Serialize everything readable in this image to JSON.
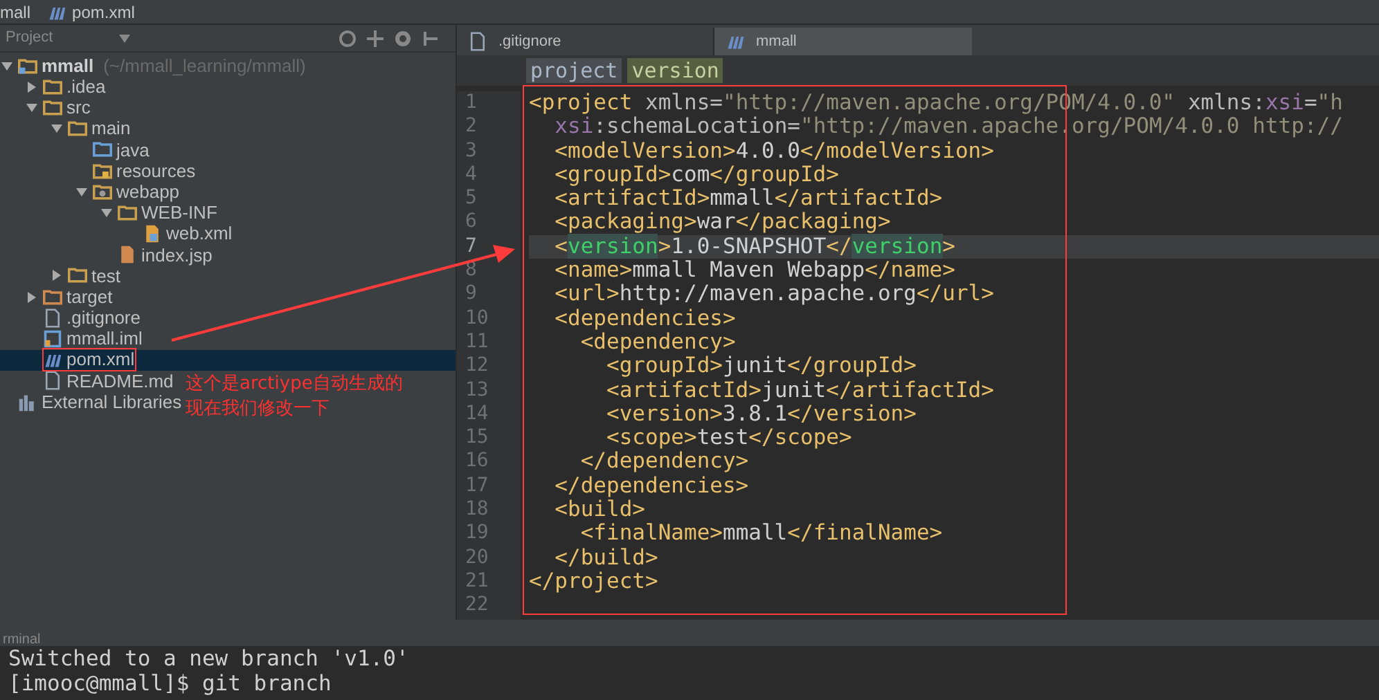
{
  "title_bar": {
    "crumbs": [
      "mall",
      "pom.xml"
    ]
  },
  "project_panel": {
    "title": "Project",
    "tree": [
      {
        "label": "mmall",
        "hint": "(~/mmall_learning/mmall)",
        "kind": "module",
        "expanded": true,
        "selected": false,
        "children": [
          {
            "label": ".idea",
            "kind": "folder",
            "expanded": false,
            "selected": false
          },
          {
            "label": "src",
            "kind": "folder",
            "expanded": true,
            "selected": false,
            "children": [
              {
                "label": "main",
                "kind": "folder",
                "expanded": true,
                "selected": false,
                "children": [
                  {
                    "label": "java",
                    "kind": "source",
                    "selected": false
                  },
                  {
                    "label": "resources",
                    "kind": "resources",
                    "selected": false
                  },
                  {
                    "label": "webapp",
                    "kind": "web",
                    "expanded": true,
                    "selected": false,
                    "children": [
                      {
                        "label": "WEB-INF",
                        "kind": "folder",
                        "expanded": true,
                        "selected": false,
                        "children": [
                          {
                            "label": "web.xml",
                            "kind": "xml",
                            "selected": false
                          }
                        ]
                      },
                      {
                        "label": "index.jsp",
                        "kind": "jsp",
                        "selected": false
                      }
                    ]
                  }
                ]
              },
              {
                "label": "test",
                "kind": "folder",
                "expanded": false,
                "selected": false
              }
            ]
          },
          {
            "label": "target",
            "kind": "excluded",
            "expanded": false,
            "selected": false
          },
          {
            "label": ".gitignore",
            "kind": "file",
            "selected": false
          },
          {
            "label": "mmall.iml",
            "kind": "iml",
            "selected": false
          },
          {
            "label": "pom.xml",
            "kind": "maven",
            "selected": true
          },
          {
            "label": "README.md",
            "kind": "file",
            "selected": false
          }
        ]
      },
      {
        "label": "External Libraries",
        "kind": "libraries",
        "selected": false
      }
    ]
  },
  "editor": {
    "tabs": [
      {
        "label": ".gitignore",
        "kind": "file",
        "selected": false
      },
      {
        "label": "mmall",
        "kind": "maven",
        "selected": true
      }
    ],
    "breadcrumbs": [
      {
        "label": "project",
        "selected": false
      },
      {
        "label": "version",
        "selected": true
      }
    ],
    "lines": [
      {
        "number": "1",
        "current": false,
        "tokens": [
          {
            "text": "<project",
            "kind": "tag"
          },
          {
            "text": " xmlns=",
            "kind": "attr"
          },
          {
            "text": "\"http://maven.apache.org/POM/4.0.0\"",
            "kind": "value"
          },
          {
            "text": " xmlns:",
            "kind": "attr"
          },
          {
            "text": "xsi",
            "kind": "ns"
          },
          {
            "text": "=",
            "kind": "attr"
          },
          {
            "text": "\"h",
            "kind": "value"
          }
        ]
      },
      {
        "number": "2",
        "current": false,
        "tokens": [
          {
            "text": "  xsi",
            "kind": "ns"
          },
          {
            "text": ":schemaLocation=",
            "kind": "attr"
          },
          {
            "text": "\"http://maven.apache.org/POM/4.0.0 http://",
            "kind": "value"
          }
        ]
      },
      {
        "number": "3",
        "current": false,
        "tokens": [
          {
            "text": "  <modelVersion>",
            "kind": "tag"
          },
          {
            "text": "4.0.0",
            "kind": "text"
          },
          {
            "text": "</modelVersion>",
            "kind": "tag"
          }
        ]
      },
      {
        "number": "4",
        "current": false,
        "tokens": [
          {
            "text": "  <groupId>",
            "kind": "tag"
          },
          {
            "text": "com",
            "kind": "text"
          },
          {
            "text": "</groupId>",
            "kind": "tag"
          }
        ]
      },
      {
        "number": "5",
        "current": false,
        "tokens": [
          {
            "text": "  <artifactId>",
            "kind": "tag"
          },
          {
            "text": "mmall",
            "kind": "text"
          },
          {
            "text": "</artifactId>",
            "kind": "tag"
          }
        ]
      },
      {
        "number": "6",
        "current": false,
        "tokens": [
          {
            "text": "  <packaging>",
            "kind": "tag"
          },
          {
            "text": "war",
            "kind": "text"
          },
          {
            "text": "</packaging>",
            "kind": "tag"
          }
        ]
      },
      {
        "number": "7",
        "current": true,
        "tokens": [
          {
            "text": "  <",
            "kind": "tag"
          },
          {
            "text": "version",
            "kind": "match"
          },
          {
            "text": ">",
            "kind": "tag"
          },
          {
            "text": "1.0-SNAPSHOT",
            "kind": "text"
          },
          {
            "text": "</",
            "kind": "tag"
          },
          {
            "text": "version",
            "kind": "match"
          },
          {
            "text": ">",
            "kind": "tag"
          }
        ]
      },
      {
        "number": "8",
        "current": false,
        "tokens": [
          {
            "text": "  <name>",
            "kind": "tag"
          },
          {
            "text": "mmall Maven Webapp",
            "kind": "text"
          },
          {
            "text": "</name>",
            "kind": "tag"
          }
        ]
      },
      {
        "number": "9",
        "current": false,
        "tokens": [
          {
            "text": "  <url>",
            "kind": "tag"
          },
          {
            "text": "http://maven.apache.org",
            "kind": "text"
          },
          {
            "text": "</url>",
            "kind": "tag"
          }
        ]
      },
      {
        "number": "10",
        "current": false,
        "tokens": [
          {
            "text": "  <dependencies>",
            "kind": "tag"
          }
        ]
      },
      {
        "number": "11",
        "current": false,
        "tokens": [
          {
            "text": "    <dependency>",
            "kind": "tag"
          }
        ]
      },
      {
        "number": "12",
        "current": false,
        "tokens": [
          {
            "text": "      <groupId>",
            "kind": "tag"
          },
          {
            "text": "junit",
            "kind": "text"
          },
          {
            "text": "</groupId>",
            "kind": "tag"
          }
        ]
      },
      {
        "number": "13",
        "current": false,
        "tokens": [
          {
            "text": "      <artifactId>",
            "kind": "tag"
          },
          {
            "text": "junit",
            "kind": "text"
          },
          {
            "text": "</artifactId>",
            "kind": "tag"
          }
        ]
      },
      {
        "number": "14",
        "current": false,
        "tokens": [
          {
            "text": "      <version>",
            "kind": "tag"
          },
          {
            "text": "3.8.1",
            "kind": "text"
          },
          {
            "text": "</version>",
            "kind": "tag"
          }
        ]
      },
      {
        "number": "15",
        "current": false,
        "tokens": [
          {
            "text": "      <scope>",
            "kind": "tag"
          },
          {
            "text": "test",
            "kind": "text"
          },
          {
            "text": "</scope>",
            "kind": "tag"
          }
        ]
      },
      {
        "number": "16",
        "current": false,
        "tokens": [
          {
            "text": "    </dependency>",
            "kind": "tag"
          }
        ]
      },
      {
        "number": "17",
        "current": false,
        "tokens": [
          {
            "text": "  </dependencies>",
            "kind": "tag"
          }
        ]
      },
      {
        "number": "18",
        "current": false,
        "tokens": [
          {
            "text": "  <build>",
            "kind": "tag"
          }
        ]
      },
      {
        "number": "19",
        "current": false,
        "tokens": [
          {
            "text": "    <finalName>",
            "kind": "tag"
          },
          {
            "text": "mmall",
            "kind": "text"
          },
          {
            "text": "</finalName>",
            "kind": "tag"
          }
        ]
      },
      {
        "number": "20",
        "current": false,
        "tokens": [
          {
            "text": "  </build>",
            "kind": "tag"
          }
        ]
      },
      {
        "number": "21",
        "current": false,
        "tokens": [
          {
            "text": "</project>",
            "kind": "tag"
          }
        ]
      },
      {
        "number": "22",
        "current": false
      }
    ]
  },
  "terminal": {
    "title": "rminal",
    "lines": [
      "Switched to a new branch 'v1.0'",
      "[imooc@mmall]$ git branch"
    ]
  },
  "annotation": {
    "note_lines": [
      "这个是arctiype自动生成的",
      "现在我们修改一下"
    ]
  }
}
